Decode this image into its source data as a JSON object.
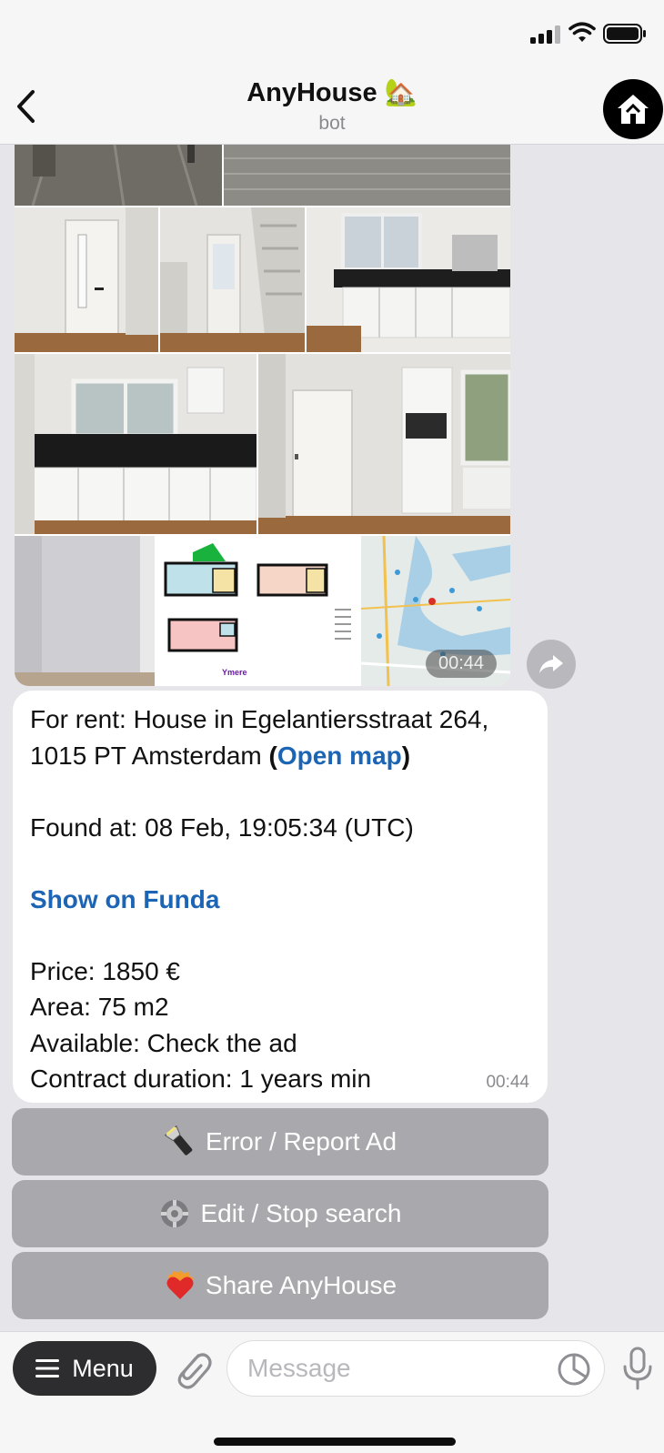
{
  "header": {
    "title": "AnyHouse 🏡",
    "subtitle": "bot"
  },
  "album": {
    "timestamp": "00:44",
    "floorplan_brand": "Ymere"
  },
  "message": {
    "line1": "For rent: House in Egelantiersstraat 264,",
    "line2_prefix": "1015 PT Amsterdam ",
    "paren_open": "(",
    "open_map_link": "Open map",
    "paren_close": ")",
    "found_at": "Found at: 08 Feb, 19:05:34 (UTC)",
    "funda_link": "Show on Funda",
    "price": "Price: 1850 €",
    "area": "Area: 75 m2",
    "available": "Available: Check the ad",
    "contract": "Contract duration: 1 years min",
    "time": "00:44"
  },
  "keyboard": {
    "report_label": "Error / Report Ad",
    "report_icon": "flashlight-icon",
    "edit_label": "Edit / Stop search",
    "edit_icon": "gear-icon",
    "share_label": "Share AnyHouse",
    "share_icon": "heart-on-fire-icon"
  },
  "input": {
    "menu_label": "Menu",
    "placeholder": "Message",
    "value": ""
  }
}
